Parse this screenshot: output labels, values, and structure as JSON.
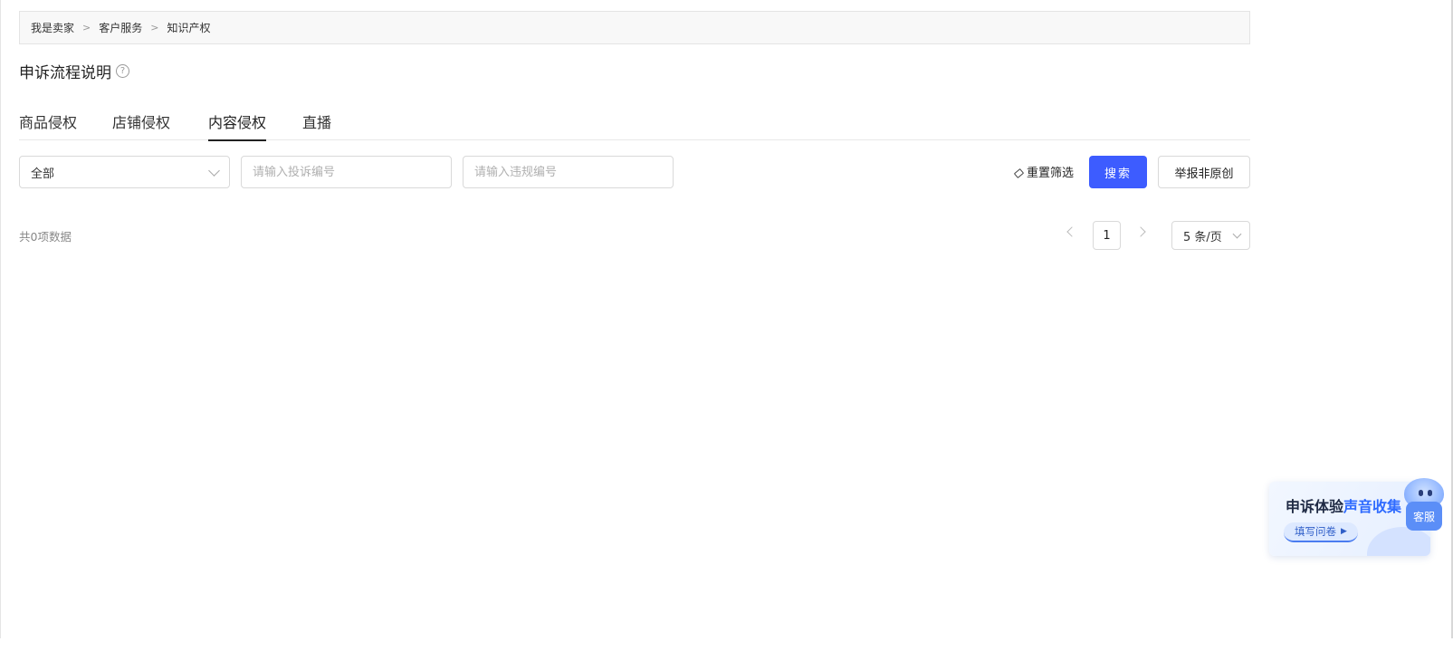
{
  "breadcrumb": {
    "items": [
      "我是卖家",
      "客户服务",
      "知识产权"
    ],
    "separator": ">"
  },
  "flow": {
    "title": "申诉流程说明",
    "help_icon": "?"
  },
  "tabs": [
    {
      "label": "商品侵权",
      "active": false
    },
    {
      "label": "店铺侵权",
      "active": false
    },
    {
      "label": "内容侵权",
      "active": true
    },
    {
      "label": "直播",
      "active": false
    }
  ],
  "filters": {
    "select_value": "全部",
    "complaint_placeholder": "请输入投诉编号",
    "violation_placeholder": "请输入违规编号",
    "reset_label": "重置筛选",
    "search_label": "搜索",
    "report_label": "举报非原创"
  },
  "list": {
    "total_text": "共0项数据"
  },
  "pagination": {
    "current_page": "1",
    "page_size": "5 条/页"
  },
  "survey": {
    "title_prefix": "申诉体验",
    "title_highlight": "声音收集",
    "button_label": "填写问卷",
    "button_arrow": "▶"
  },
  "service": {
    "label": "客服"
  },
  "colors": {
    "primary": "#3d5cff",
    "highlight": "#2f6bff"
  }
}
